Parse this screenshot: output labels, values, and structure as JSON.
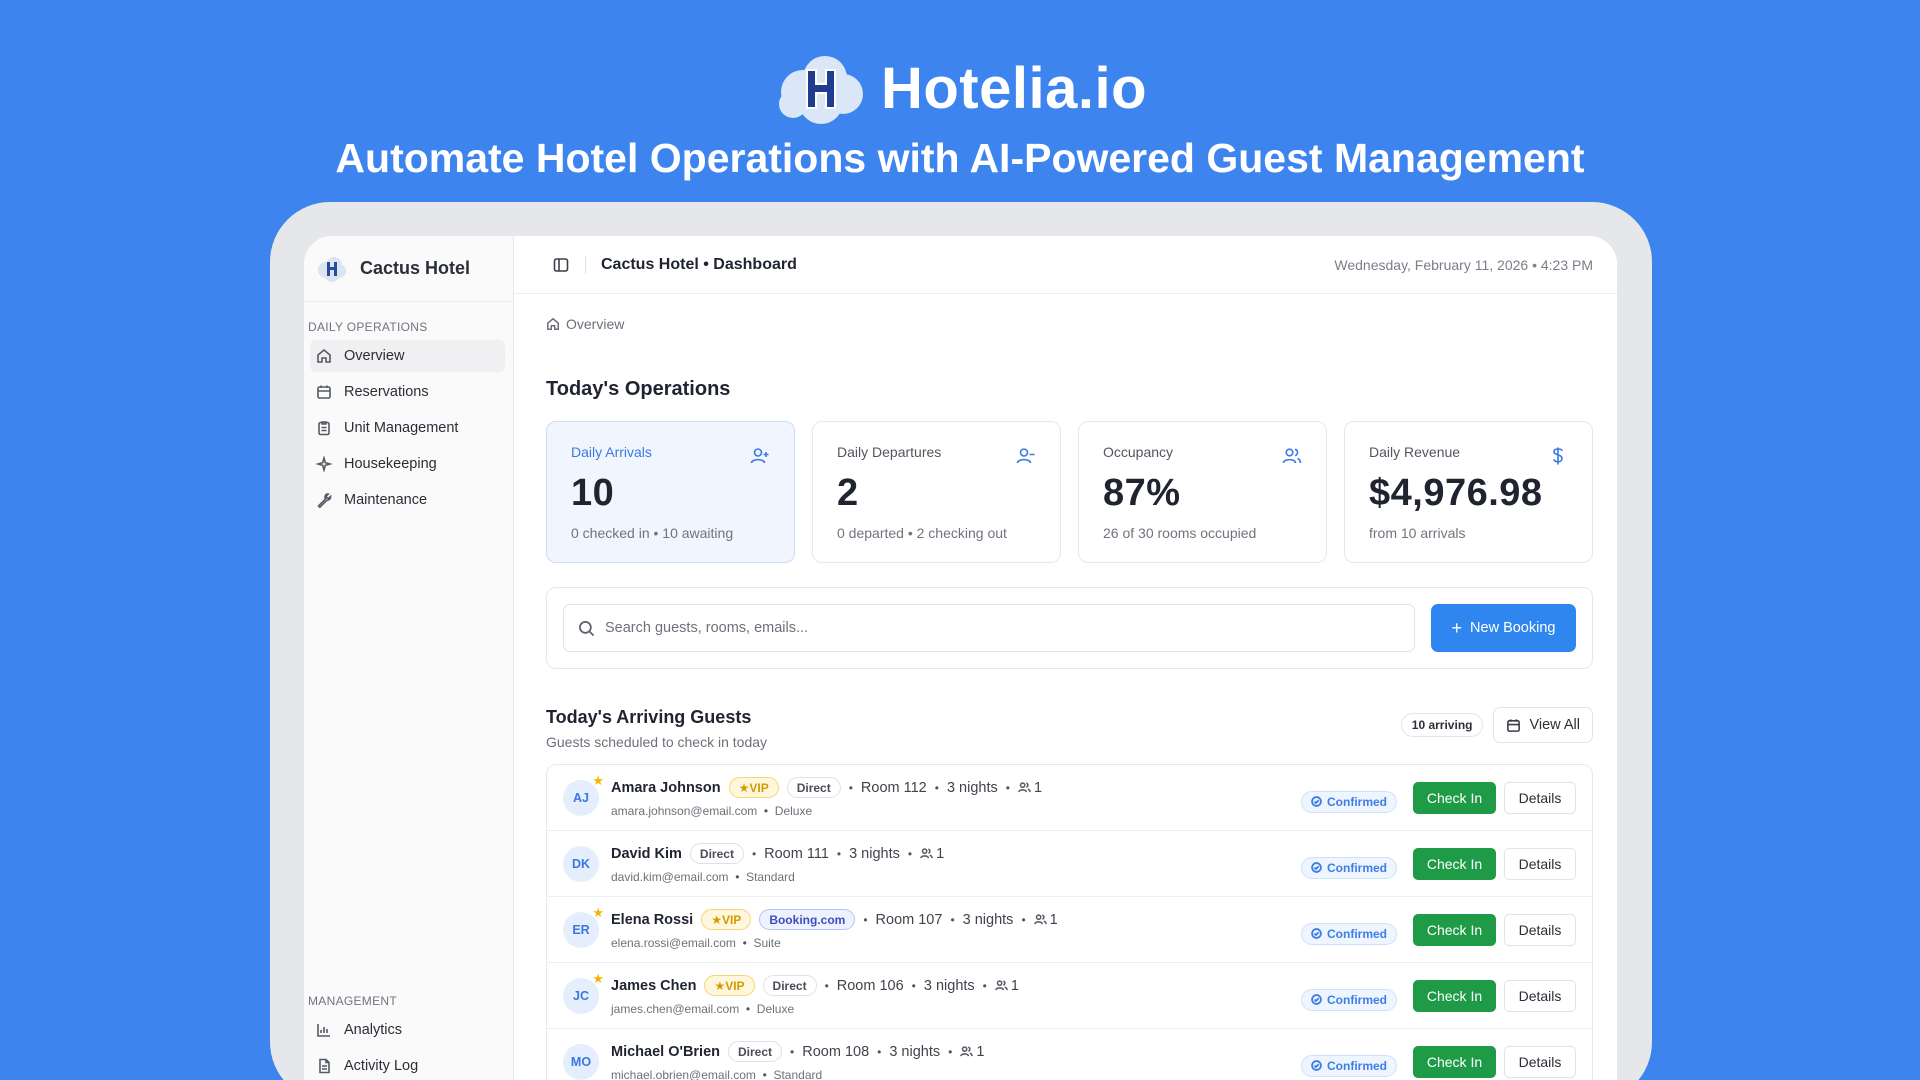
{
  "hero": {
    "brand_name": "Hotelia.io",
    "tagline": "Automate Hotel Operations with AI-Powered Guest Management"
  },
  "sidebar": {
    "hotel_name": "Cactus Hotel",
    "daily_section": "DAILY OPERATIONS",
    "daily_items": [
      {
        "label": "Overview",
        "icon": "home-icon",
        "active": true
      },
      {
        "label": "Reservations",
        "icon": "calendar-icon"
      },
      {
        "label": "Unit Management",
        "icon": "clipboard-icon"
      },
      {
        "label": "Housekeeping",
        "icon": "sparkle-icon"
      },
      {
        "label": "Maintenance",
        "icon": "wrench-icon"
      }
    ],
    "management_section": "MANAGEMENT",
    "management_items": [
      {
        "label": "Analytics",
        "icon": "bar-chart-icon"
      },
      {
        "label": "Activity Log",
        "icon": "document-icon"
      }
    ]
  },
  "topbar": {
    "title": "Cactus Hotel • Dashboard",
    "datetime": "Wednesday, February 11, 2026 • 4:23 PM"
  },
  "breadcrumb": "Overview",
  "operations": {
    "title": "Today's Operations",
    "stats": [
      {
        "label": "Daily Arrivals",
        "value": "10",
        "sub": "0 checked in • 10 awaiting",
        "icon": "user-plus-icon"
      },
      {
        "label": "Daily Departures",
        "value": "2",
        "sub": "0 departed • 2 checking out",
        "icon": "user-minus-icon"
      },
      {
        "label": "Occupancy",
        "value": "87%",
        "sub": "26 of 30 rooms occupied",
        "icon": "users-icon"
      },
      {
        "label": "Daily Revenue",
        "value": "$4,976.98",
        "sub": "from 10 arrivals",
        "icon": "dollar-icon"
      }
    ]
  },
  "search": {
    "placeholder": "Search guests, rooms, emails...",
    "new_booking": "New Booking"
  },
  "arrivals": {
    "title": "Today's Arriving Guests",
    "subtitle": "Guests scheduled to check in today",
    "count_badge": "10 arriving",
    "view_all": "View All",
    "checkin_label": "Check In",
    "details_label": "Details",
    "guests": [
      {
        "initials": "AJ",
        "name": "Amara Johnson",
        "vip": "VIP",
        "source": "Direct",
        "room": "Room 112",
        "nights": "3 nights",
        "guests": "1",
        "email": "amara.johnson@email.com",
        "room_type": "Deluxe",
        "status": "Confirmed"
      },
      {
        "initials": "DK",
        "name": "David Kim",
        "vip": "",
        "source": "Direct",
        "room": "Room 111",
        "nights": "3 nights",
        "guests": "1",
        "email": "david.kim@email.com",
        "room_type": "Standard",
        "status": "Confirmed"
      },
      {
        "initials": "ER",
        "name": "Elena Rossi",
        "vip": "VIP",
        "source": "Booking.com",
        "room": "Room 107",
        "nights": "3 nights",
        "guests": "1",
        "email": "elena.rossi@email.com",
        "room_type": "Suite",
        "status": "Confirmed"
      },
      {
        "initials": "JC",
        "name": "James Chen",
        "vip": "VIP",
        "source": "Direct",
        "room": "Room 106",
        "nights": "3 nights",
        "guests": "1",
        "email": "james.chen@email.com",
        "room_type": "Deluxe",
        "status": "Confirmed"
      },
      {
        "initials": "MO",
        "name": "Michael O'Brien",
        "vip": "",
        "source": "Direct",
        "room": "Room 108",
        "nights": "3 nights",
        "guests": "1",
        "email": "michael.obrien@email.com",
        "room_type": "Standard",
        "status": "Confirmed"
      }
    ]
  },
  "colors": {
    "background": "#3d84ef",
    "primary": "#2f86ef",
    "success": "#1f9b48",
    "vip": "#f4b400"
  }
}
